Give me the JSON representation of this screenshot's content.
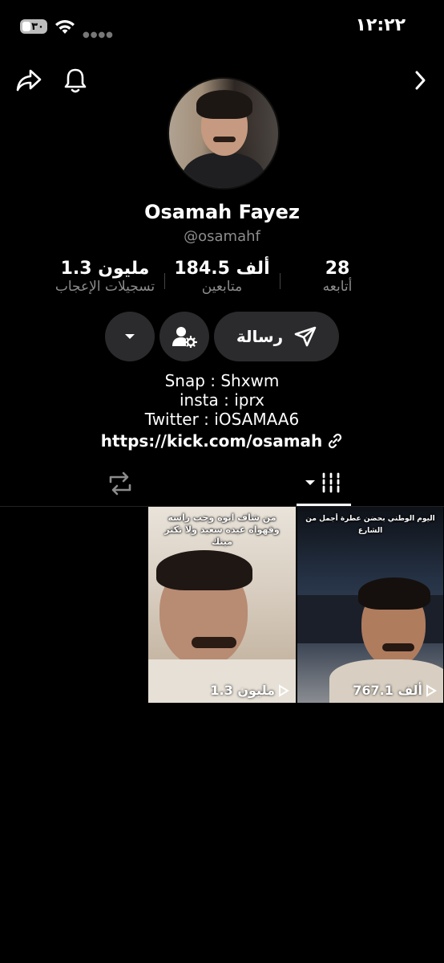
{
  "status": {
    "time": "١٢:٢٢",
    "battery": "٣٠"
  },
  "profile": {
    "name": "Osamah Fayez",
    "handle": "@osamahf"
  },
  "stats": {
    "likes": {
      "value": "1.3 مليون",
      "label": "تسجيلات الإعجاب"
    },
    "followers": {
      "value": "184.5 ألف",
      "label": "متابعين"
    },
    "following": {
      "value": "28",
      "label": "أتابعه"
    }
  },
  "actions": {
    "message_label": "رسالة"
  },
  "bio": {
    "line1": "Snap : Shxwm",
    "line2": "insta : iprx",
    "line3": "Twitter : iOSAMAA6",
    "link": "https://kick.com/osamah"
  },
  "videos": [
    {
      "caption": "من شاف ابوه وحب راسه وقهواه عيده سعيد ولا تكثر مينك",
      "views": "1.3 مليون"
    },
    {
      "caption": "اليوم الوطني بحضن عطرة أجمل من الشارع",
      "views": "767.1 ألف"
    }
  ],
  "icons": [
    "battery-icon",
    "wifi-icon",
    "share-icon",
    "bell-icon",
    "chevron-right-icon",
    "send-icon",
    "user-settings-icon",
    "dropdown-icon",
    "link-icon",
    "repost-icon",
    "grid-icon",
    "play-icon"
  ],
  "colors": {
    "background": "#000000",
    "button": "#2b2b2d",
    "muted": "#8c8c8c"
  }
}
